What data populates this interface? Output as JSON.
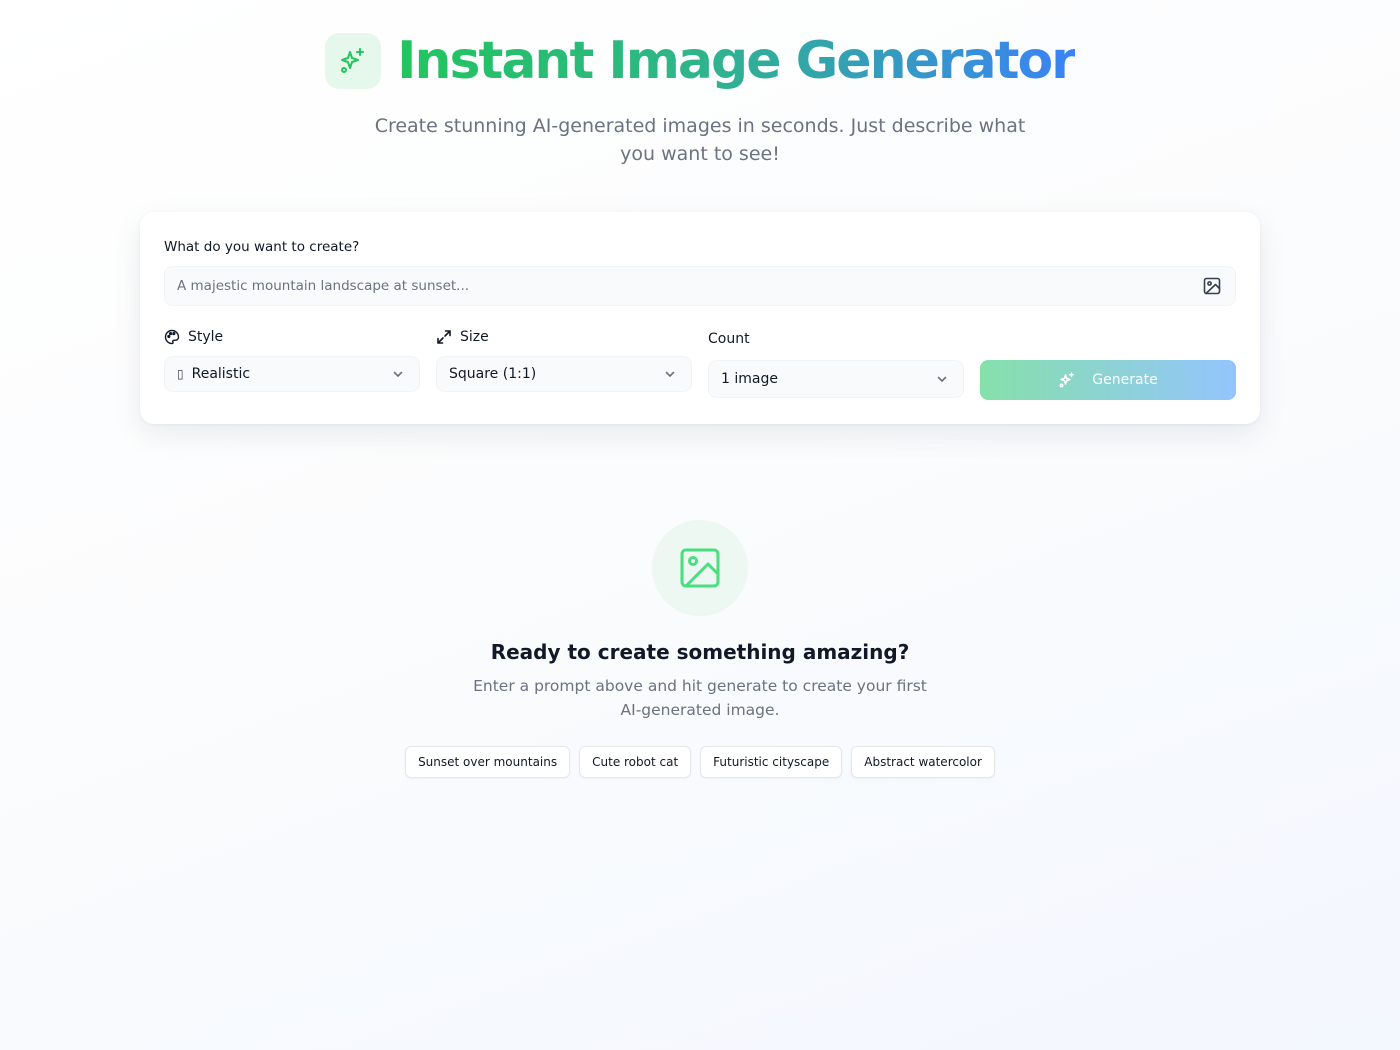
{
  "header": {
    "logo_icon": "sparkles-icon",
    "title": "Instant Image Generator",
    "subtitle": "Create stunning AI-generated images in seconds. Just describe what you want to see!"
  },
  "form": {
    "prompt_label": "What do you want to create?",
    "prompt_placeholder": "A majestic mountain landscape at sunset...",
    "prompt_value": "",
    "prompt_icon": "image-icon",
    "style": {
      "label": "Style",
      "icon": "palette-icon",
      "value": "Realistic",
      "value_glyph": "▯"
    },
    "size": {
      "label": "Size",
      "icon": "expand-icon",
      "value": "Square (1:1)"
    },
    "count": {
      "label": "Count",
      "value": "1 image"
    },
    "generate_label": "Generate",
    "generate_icon": "sparkles-icon"
  },
  "empty_state": {
    "icon": "image-icon",
    "title": "Ready to create something amazing?",
    "description": "Enter a prompt above and hit generate to create your first AI-generated image.",
    "suggestions": [
      "Sunset over mountains",
      "Cute robot cat",
      "Futuristic cityscape",
      "Abstract watercolor"
    ]
  },
  "colors": {
    "brand_green": "#22c55e",
    "brand_blue": "#3b82f6",
    "text_primary": "#111827",
    "text_muted": "#6b7280"
  }
}
